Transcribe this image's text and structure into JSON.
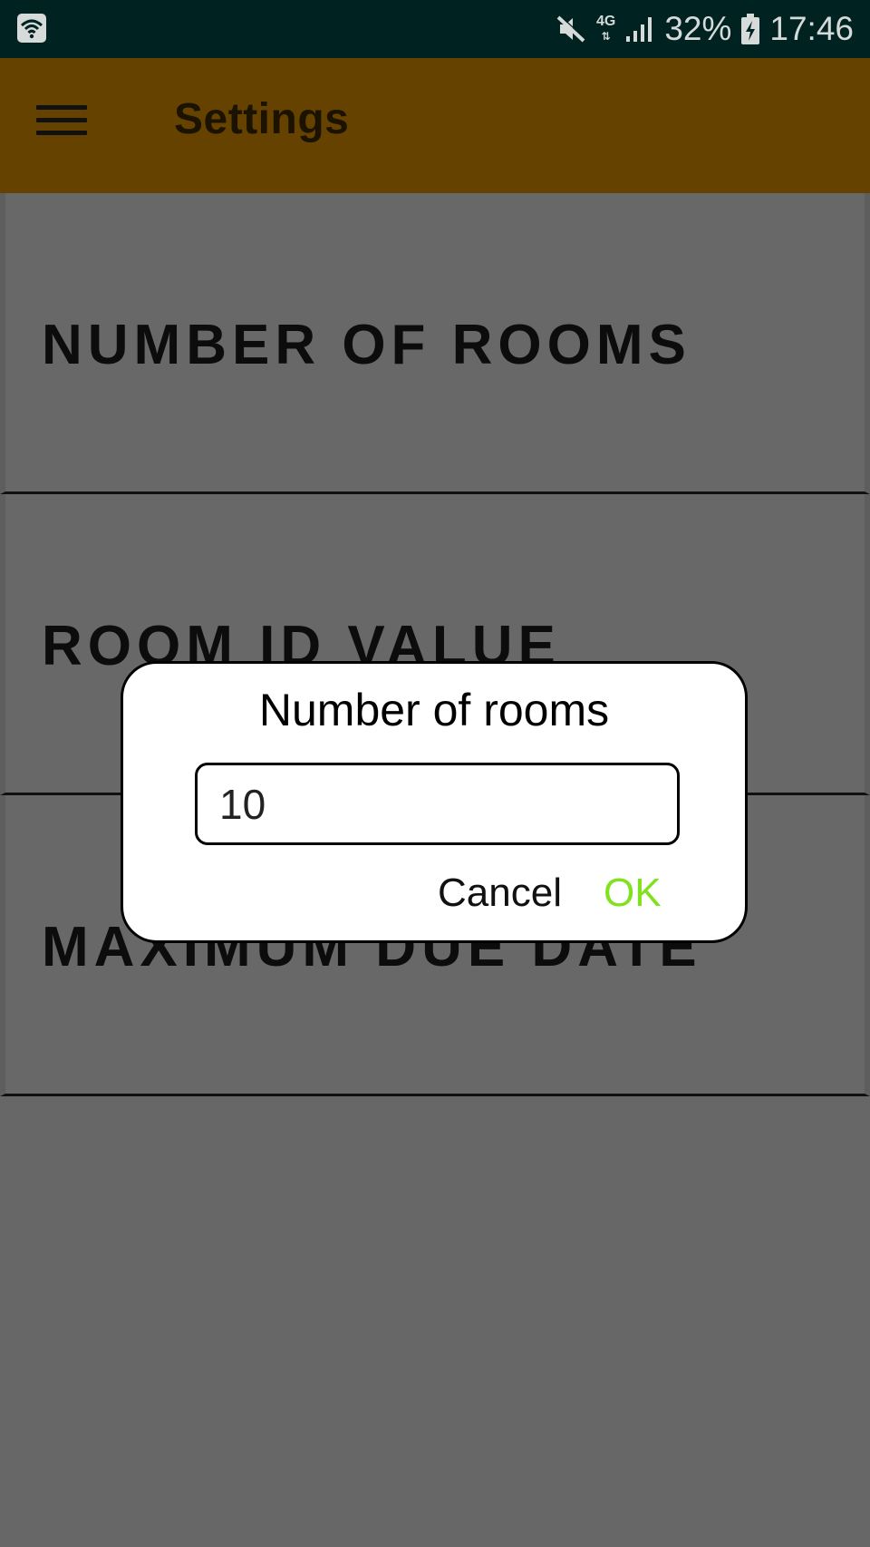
{
  "status_bar": {
    "wifi_icon": "wifi-icon",
    "mute_icon": "mute-icon",
    "network_type": "4G",
    "signal_icon": "signal-icon",
    "battery_percent": "32%",
    "battery_icon": "battery-charging-icon",
    "time": "17:46"
  },
  "toolbar": {
    "menu_icon": "hamburger-menu-icon",
    "title": "Settings",
    "background": "#654200"
  },
  "settings": {
    "items": [
      {
        "label": "NUMBER OF ROOMS"
      },
      {
        "label": "ROOM ID VALUE"
      },
      {
        "label": "MAXIMUM DUE DATE"
      }
    ]
  },
  "dialog": {
    "title": "Number of rooms",
    "input_value": "10",
    "cancel_label": "Cancel",
    "ok_label": "OK",
    "ok_color": "#7fe21c"
  }
}
